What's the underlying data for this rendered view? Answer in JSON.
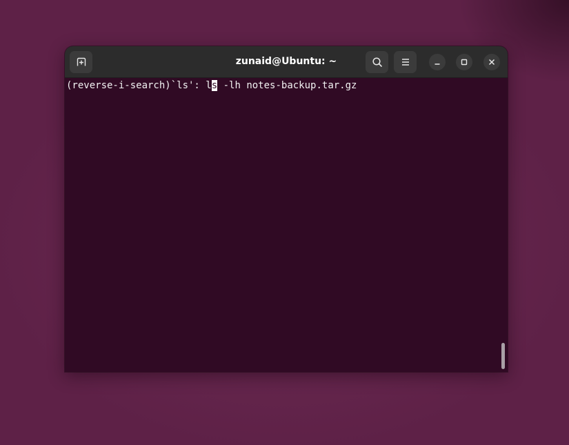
{
  "window": {
    "title": "zunaid@Ubuntu: ~"
  },
  "titlebar": {
    "buttons": {
      "new_tab": "new-tab-icon",
      "search": "search-icon",
      "menu": "hamburger-menu-icon",
      "minimize": "minimize-icon",
      "maximize": "maximize-icon",
      "close": "close-icon"
    }
  },
  "terminal": {
    "prompt": "(reverse-i-search)`ls': ",
    "match_before_cursor": "l",
    "cursor_char": "s",
    "match_after_cursor": " -lh notes-backup.tar.gz"
  },
  "colors": {
    "terminal_bg": "#300a24",
    "titlebar_bg": "#2c2c2c",
    "desktop_bg": "#64254c",
    "text": "#f2f2f2"
  }
}
